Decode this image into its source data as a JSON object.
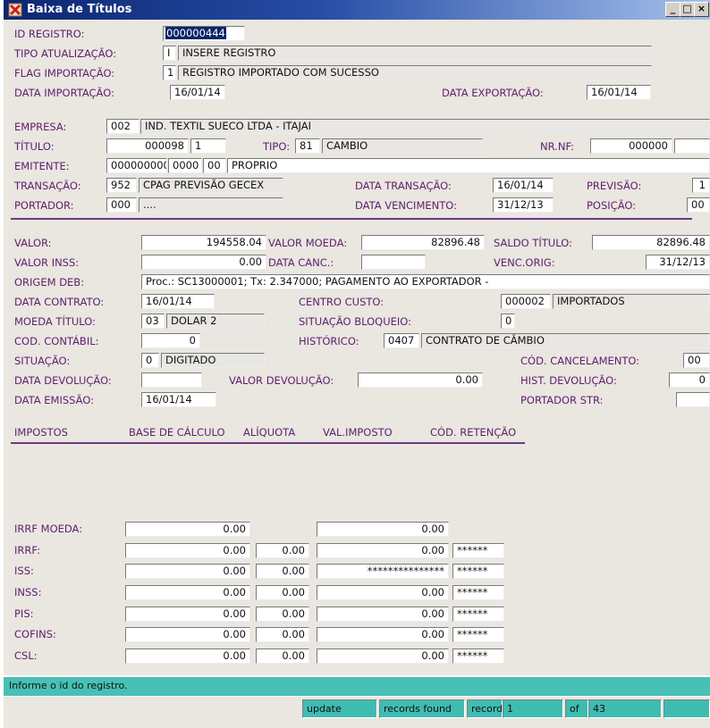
{
  "window": {
    "title": "Baixa de Títulos",
    "minimize": "_",
    "maximize": "□",
    "close": "×"
  },
  "registro": {
    "id_label": "ID REGISTRO:",
    "id_value": "000000444",
    "tipo_label": "TIPO ATUALIZAÇÃO:",
    "tipo_code": "I",
    "tipo_desc": "INSERE REGISTRO",
    "flag_label": "FLAG IMPORTAÇÃO:",
    "flag_code": "1",
    "flag_desc": "REGISTRO IMPORTADO COM SUCESSO",
    "data_imp_label": "DATA IMPORTAÇÃO:",
    "data_imp_value": "16/01/14",
    "data_exp_label": "DATA EXPORTAÇÃO:",
    "data_exp_value": "16/01/14"
  },
  "empresa": {
    "label": "EMPRESA:",
    "code": "002",
    "name": "IND. TEXTIL SUECO LTDA - ITAJAI",
    "titulo_label": "TÍTULO:",
    "titulo_num": "000098",
    "titulo_seq": "1",
    "tipo_label": "TIPO:",
    "tipo_code": "81",
    "tipo_desc": "CAMBIO",
    "nrnf_label": "NR.NF:",
    "nrnf_value": "000000",
    "nrnf_extra": "",
    "emitente_label": "EMITENTE:",
    "emitente_code": "000000000",
    "emitente_c2": "0000",
    "emitente_c3": "00",
    "emitente_desc": "PROPRIO",
    "transacao_label": "TRANSAÇÃO:",
    "transacao_code": "952",
    "transacao_desc": "CPAG PREVISÃO GECEX",
    "data_transacao_label": "DATA TRANSAÇÃO:",
    "data_transacao_value": "16/01/14",
    "previsao_label": "PREVISÃO:",
    "previsao_value": "1",
    "portador_label": "PORTADOR:",
    "portador_code": "000",
    "portador_desc": "....",
    "data_venc_label": "DATA VENCIMENTO:",
    "data_venc_value": "31/12/13",
    "posicao_label": "POSIÇÃO:",
    "posicao_value": "00"
  },
  "valores": {
    "valor_label": "VALOR:",
    "valor_value": "194558.04",
    "valor_moeda_label": "VALOR MOEDA:",
    "valor_moeda_value": "82896.48",
    "saldo_label": "SALDO TÍTULO:",
    "saldo_value": "82896.48",
    "valor_inss_label": "VALOR INSS:",
    "valor_inss_value": "0.00",
    "data_canc_label": "DATA CANC.:",
    "data_canc_value": "",
    "venc_orig_label": "VENC.ORIG:",
    "venc_orig_value": "31/12/13",
    "origem_label": "ORIGEM DEB:",
    "origem_value": "Proc.: SC13000001; Tx: 2.347000; PAGAMENTO AO EXPORTADOR -",
    "data_contrato_label": "DATA CONTRATO:",
    "data_contrato_value": "16/01/14",
    "centro_label": "CENTRO CUSTO:",
    "centro_code": "000002",
    "centro_desc": "IMPORTADOS",
    "moeda_label": "MOEDA TÍTULO:",
    "moeda_code": "03",
    "moeda_desc": "DOLAR 2",
    "situacao_bloq_label": "SITUAÇÃO BLOQUEIO:",
    "situacao_bloq_value": "0",
    "cod_contabil_label": "COD. CONTÁBIL:",
    "cod_contabil_value": "0",
    "historico_label": "HISTÓRICO:",
    "historico_code": "0407",
    "historico_desc": "CONTRATO DE CÂMBIO",
    "situacao_label": "SITUAÇÃO:",
    "situacao_code": "0",
    "situacao_desc": "DIGITADO",
    "cod_canc_label": "CÓD. CANCELAMENTO:",
    "cod_canc_value": "00",
    "data_dev_label": "DATA DEVOLUÇÃO:",
    "data_dev_value": "",
    "valor_dev_label": "VALOR DEVOLUÇÃO:",
    "valor_dev_value": "0.00",
    "hist_dev_label": "HIST. DEVOLUÇÃO:",
    "hist_dev_value": "0",
    "data_emissao_label": "DATA EMISSÃO:",
    "data_emissao_value": "16/01/14",
    "portador_str_label": "PORTADOR STR:",
    "portador_str_value": ""
  },
  "impostos": {
    "headers": [
      "IMPOSTOS",
      "BASE DE CÁLCULO",
      "ALÍQUOTA",
      "VAL.IMPOSTO",
      "CÓD. RETENÇÃO"
    ],
    "rows": [
      {
        "name": "IRRF MOEDA:",
        "base": "0.00",
        "aliquota": null,
        "valor": "0.00",
        "codigo": null
      },
      {
        "name": "IRRF:",
        "base": "0.00",
        "aliquota": "0.00",
        "valor": "0.00",
        "codigo": "******"
      },
      {
        "name": "ISS:",
        "base": "0.00",
        "aliquota": "0.00",
        "valor": "***************",
        "codigo": "******"
      },
      {
        "name": "INSS:",
        "base": "0.00",
        "aliquota": "0.00",
        "valor": "0.00",
        "codigo": "******"
      },
      {
        "name": "PIS:",
        "base": "0.00",
        "aliquota": "0.00",
        "valor": "0.00",
        "codigo": "******"
      },
      {
        "name": "COFINS:",
        "base": "0.00",
        "aliquota": "0.00",
        "valor": "0.00",
        "codigo": "******"
      },
      {
        "name": "CSL:",
        "base": "0.00",
        "aliquota": "0.00",
        "valor": "0.00",
        "codigo": "******"
      }
    ]
  },
  "status": {
    "message": "Informe o id do registro.",
    "mode": "update",
    "records_found": "records found",
    "record_label": "record",
    "record_value": "1",
    "of_label": "of",
    "of_value": "43"
  },
  "colors": {
    "title_bar": "#0c2670",
    "label": "#5c1f6e",
    "status_bar": "#48c0b6",
    "form_bg": "#eae6e0"
  },
  "icons": {
    "app": "red-x-window-icon"
  }
}
